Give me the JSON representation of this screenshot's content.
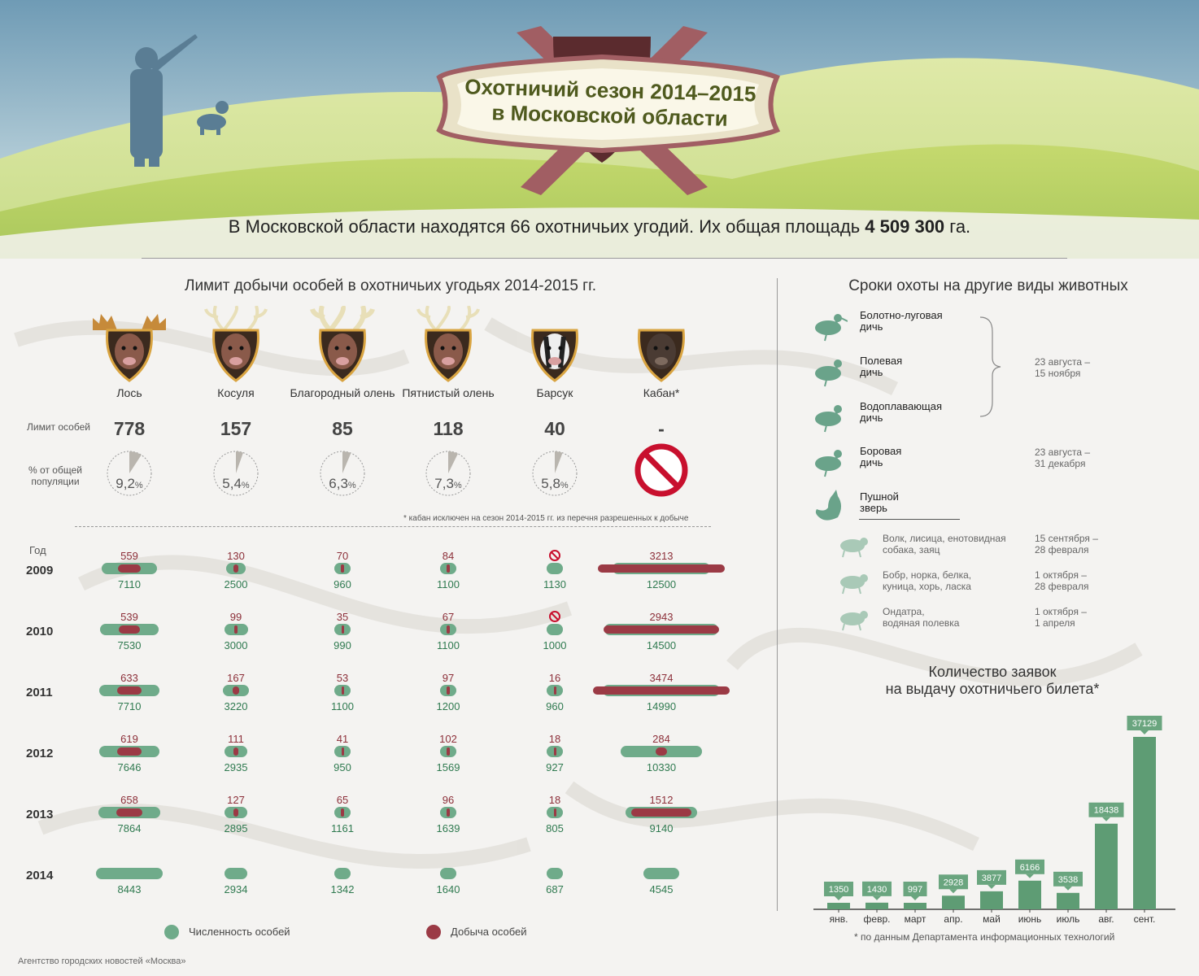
{
  "header": {
    "title_line1": "Охотничий сезон 2014–2015",
    "title_line2": "в Московской области",
    "subtitle_pre": "В Московской области находятся 66 охотничьих угодий. Их общая площадь ",
    "subtitle_bold": "4 509 300",
    "subtitle_post": " га."
  },
  "limit_section": {
    "title": "Лимит добычи особей в охотничьих угодьях 2014-2015 гг.",
    "limit_label": "Лимит особей",
    "pct_label": "% от общей популяции",
    "note": "* кабан исключен на сезон 2014-2015 гг. из перечня разрешенных к добыче",
    "animals": [
      {
        "name": "Лось",
        "limit": "778",
        "pct": "9,2",
        "pct_value": 9.2
      },
      {
        "name": "Косуля",
        "limit": "157",
        "pct": "5,4",
        "pct_value": 5.4
      },
      {
        "name": "Благородный олень",
        "limit": "85",
        "pct": "6,3",
        "pct_value": 6.3
      },
      {
        "name": "Пятнистый олень",
        "limit": "118",
        "pct": "7,3",
        "pct_value": 7.3
      },
      {
        "name": "Барсук",
        "limit": "40",
        "pct": "5,8",
        "pct_value": 5.8
      },
      {
        "name": "Кабан*",
        "limit": "-",
        "pct": "",
        "pct_value": null
      }
    ],
    "pct_unit": "%"
  },
  "years_section": {
    "year_header": "Год",
    "years": [
      "2009",
      "2010",
      "2011",
      "2012",
      "2013",
      "2014"
    ],
    "harvest": [
      [
        "559",
        "130",
        "70",
        "84",
        "",
        "3213"
      ],
      [
        "539",
        "99",
        "35",
        "67",
        "",
        "2943"
      ],
      [
        "633",
        "167",
        "53",
        "97",
        "16",
        "3474"
      ],
      [
        "619",
        "111",
        "41",
        "102",
        "18",
        "284"
      ],
      [
        "658",
        "127",
        "65",
        "96",
        "18",
        "1512"
      ],
      [
        "",
        "",
        "",
        "",
        "",
        ""
      ]
    ],
    "harvest_banned": [
      [
        false,
        false,
        false,
        false,
        true,
        false
      ],
      [
        false,
        false,
        false,
        false,
        true,
        false
      ],
      [
        false,
        false,
        false,
        false,
        false,
        false
      ],
      [
        false,
        false,
        false,
        false,
        false,
        false
      ],
      [
        false,
        false,
        false,
        false,
        false,
        false
      ],
      [
        false,
        false,
        false,
        false,
        false,
        false
      ]
    ],
    "population": [
      [
        "7110",
        "2500",
        "960",
        "1100",
        "1130",
        "12500"
      ],
      [
        "7530",
        "3000",
        "990",
        "1100",
        "1000",
        "14500"
      ],
      [
        "7710",
        "3220",
        "1100",
        "1200",
        "960",
        "14990"
      ],
      [
        "7646",
        "2935",
        "950",
        "1569",
        "927",
        "10330"
      ],
      [
        "7864",
        "2895",
        "1161",
        "1639",
        "805",
        "9140"
      ],
      [
        "8443",
        "2934",
        "1342",
        "1640",
        "687",
        "4545"
      ]
    ],
    "legend_population": "Численность особей",
    "legend_harvest": "Добыча особей",
    "colors": {
      "population": "#6fab8a",
      "harvest": "#9b3a45"
    }
  },
  "seasons_section": {
    "title": "Сроки охоты на другие виды животных",
    "groups": [
      {
        "name_line1": "Болотно-луговая",
        "name_line2": "дичь",
        "icon": "snipe-icon"
      },
      {
        "name_line1": "Полевая",
        "name_line2": "дичь",
        "icon": "grouse-icon"
      },
      {
        "name_line1": "Водоплавающая",
        "name_line2": "дичь",
        "icon": "duck-icon"
      },
      {
        "name_line1": "Боровая",
        "name_line2": "дичь",
        "icon": "capercaillie-icon"
      },
      {
        "name_line1": "Пушной",
        "name_line2": "зверь",
        "icon": "fox-icon"
      }
    ],
    "dates_birds_1": "23 августа –",
    "dates_birds_2": "15 ноября",
    "dates_forest_1": "23 августа –",
    "dates_forest_2": "31 декабря",
    "fur": [
      {
        "line1": "Волк, лисица, енотовидная",
        "line2": "собака, заяц",
        "date1": "15 сентября  –",
        "date2": "28 февраля",
        "icon": "wolf-icon"
      },
      {
        "line1": "Бобр, норка, белка,",
        "line2": "куница, хорь, ласка",
        "date1": "1 октября –",
        "date2": "28 февраля",
        "icon": "beaver-icon"
      },
      {
        "line1": "Ондатра,",
        "line2": "водяная полевка",
        "date1": "1 октября –",
        "date2": "1 апреля",
        "icon": "muskrat-icon"
      }
    ]
  },
  "applications_section": {
    "title_line1": "Количество заявок",
    "title_line2": "на выдачу охотничьего билета*",
    "footnote": "* по данным Департамента информационных технологий"
  },
  "chart_data": {
    "type": "bar",
    "categories": [
      "янв.",
      "февр.",
      "март",
      "апр.",
      "май",
      "июнь",
      "июль",
      "авг.",
      "сент."
    ],
    "values": [
      1350,
      1430,
      997,
      2928,
      3877,
      6166,
      3538,
      18438,
      37129
    ],
    "title": "Количество заявок на выдачу охотничьего билета*",
    "xlabel": "",
    "ylabel": "",
    "ylim": [
      0,
      37129
    ],
    "color": "#5e9c74"
  },
  "footer": {
    "credit": "Агентство городских новостей «Москва»"
  }
}
